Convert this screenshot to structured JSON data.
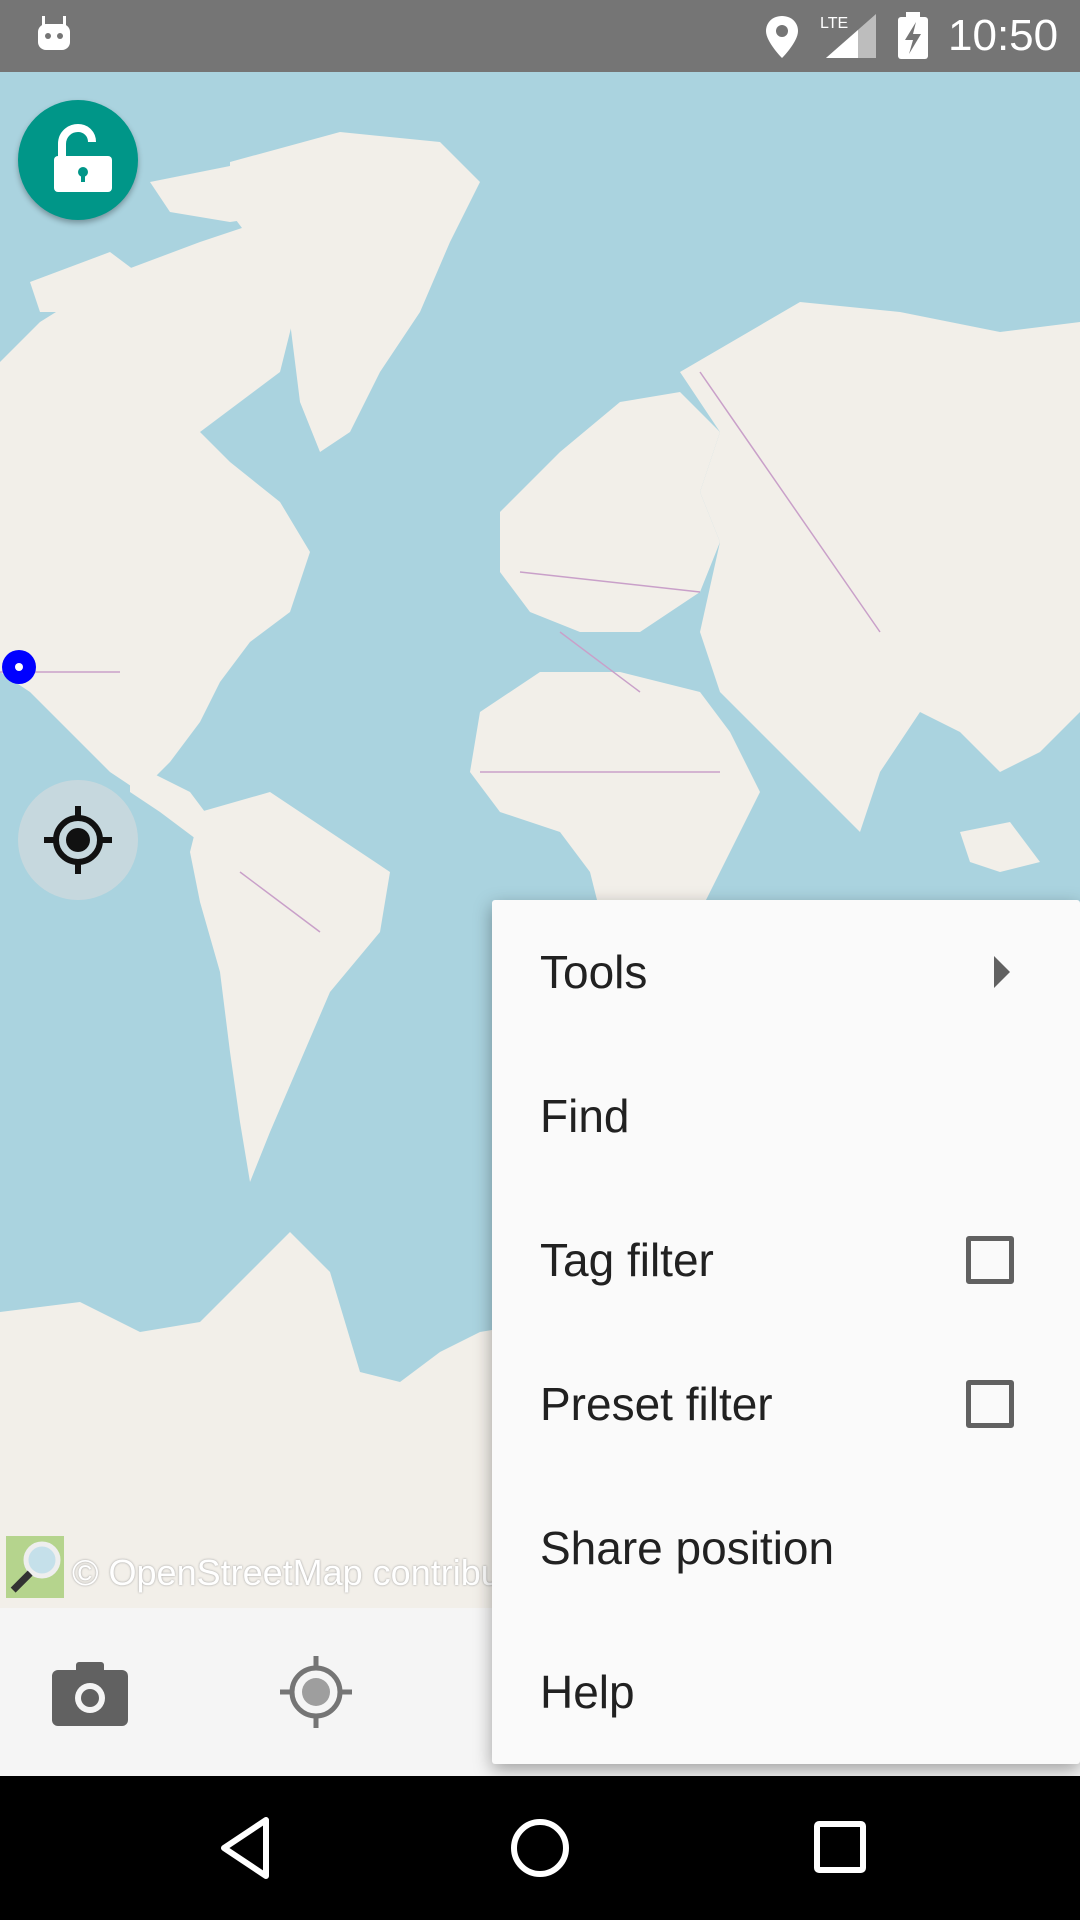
{
  "status_bar": {
    "time": "10:50",
    "network": "LTE",
    "icons": [
      "android-icon",
      "location-icon",
      "signal-icon",
      "battery-charging-icon"
    ]
  },
  "map": {
    "attribution": "© OpenStreetMap contribu",
    "colors": {
      "water": "#aad3df",
      "land": "#f2efe9",
      "borders": "#c9a0c9"
    }
  },
  "buttons": {
    "lock": {
      "icon": "unlock-icon",
      "color": "#009688"
    },
    "follow_gps": {
      "icon": "gps-target-icon"
    }
  },
  "toolbar": {
    "icons": [
      "camera-icon",
      "gps-icon"
    ]
  },
  "menu": {
    "items": [
      {
        "label": "Tools",
        "type": "submenu"
      },
      {
        "label": "Find",
        "type": "action"
      },
      {
        "label": "Tag filter",
        "type": "checkbox",
        "checked": false
      },
      {
        "label": "Preset filter",
        "type": "checkbox",
        "checked": false
      },
      {
        "label": "Share position",
        "type": "action"
      },
      {
        "label": "Help",
        "type": "action"
      }
    ]
  },
  "nav_bar": {
    "icons": [
      "back-icon",
      "home-icon",
      "recents-icon"
    ]
  }
}
